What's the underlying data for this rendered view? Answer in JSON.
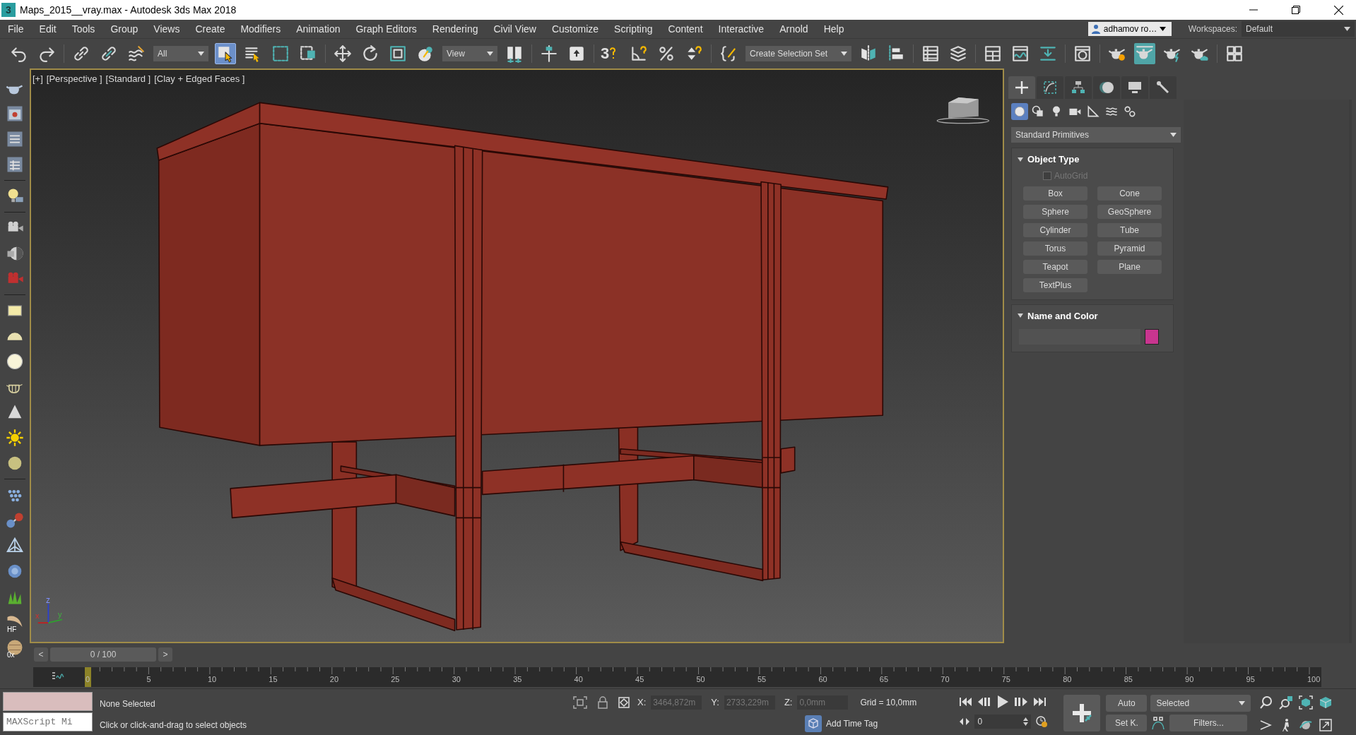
{
  "window": {
    "title": "Maps_2015__vray.max - Autodesk 3ds Max 2018",
    "app_icon": "3"
  },
  "menu": [
    "File",
    "Edit",
    "Tools",
    "Group",
    "Views",
    "Create",
    "Modifiers",
    "Animation",
    "Graph Editors",
    "Rendering",
    "Civil View",
    "Customize",
    "Scripting",
    "Content",
    "Interactive",
    "Arnold",
    "Help"
  ],
  "account": {
    "user": "adhamov ro…"
  },
  "workspaces": {
    "label": "Workspaces:",
    "value": "Default"
  },
  "toolbar": [
    {
      "kind": "undo"
    },
    {
      "kind": "redo"
    },
    {
      "kind": "sep"
    },
    {
      "kind": "link"
    },
    {
      "kind": "unlink"
    },
    {
      "kind": "bind"
    },
    {
      "kind": "dropdown",
      "value": "All"
    },
    {
      "kind": "select",
      "on": true
    },
    {
      "kind": "select_by_name"
    },
    {
      "kind": "region"
    },
    {
      "kind": "crossing"
    },
    {
      "kind": "sep"
    },
    {
      "kind": "move"
    },
    {
      "kind": "rotate"
    },
    {
      "kind": "scale"
    },
    {
      "kind": "placement"
    },
    {
      "kind": "dropdown",
      "value": "View"
    },
    {
      "kind": "pivot"
    },
    {
      "kind": "sep"
    },
    {
      "kind": "manipulate"
    },
    {
      "kind": "keyboard"
    },
    {
      "kind": "sep"
    },
    {
      "kind": "snap",
      "label": "3"
    },
    {
      "kind": "angle"
    },
    {
      "kind": "percent"
    },
    {
      "kind": "spinner"
    },
    {
      "kind": "sep"
    },
    {
      "kind": "braces"
    },
    {
      "kind": "dropdown",
      "value": "Create Selection Set"
    },
    {
      "kind": "mirror"
    },
    {
      "kind": "align"
    },
    {
      "kind": "sep"
    },
    {
      "kind": "scene"
    },
    {
      "kind": "layer"
    },
    {
      "kind": "sep"
    },
    {
      "kind": "ribbon"
    },
    {
      "kind": "curve"
    },
    {
      "kind": "dope"
    },
    {
      "kind": "sep"
    },
    {
      "kind": "material"
    },
    {
      "kind": "sep"
    },
    {
      "kind": "render_setup"
    },
    {
      "kind": "render_frame",
      "on": true
    },
    {
      "kind": "render"
    },
    {
      "kind": "render_cloud"
    },
    {
      "kind": "sep"
    },
    {
      "kind": "tiles"
    }
  ],
  "left_toolbar": [
    {
      "kind": "teapot"
    },
    {
      "kind": "image_window"
    },
    {
      "kind": "list_window"
    },
    {
      "kind": "table_window"
    },
    {
      "kind": "sep"
    },
    {
      "kind": "bulb"
    },
    {
      "kind": "sep"
    },
    {
      "kind": "camera"
    },
    {
      "kind": "camera_moon"
    },
    {
      "kind": "camera_red"
    },
    {
      "kind": "sep"
    },
    {
      "kind": "panel"
    },
    {
      "kind": "dome"
    },
    {
      "kind": "glow"
    },
    {
      "kind": "basket"
    },
    {
      "kind": "cone"
    },
    {
      "kind": "sun"
    },
    {
      "kind": "sphere"
    },
    {
      "kind": "sep"
    },
    {
      "kind": "dots"
    },
    {
      "kind": "molecule"
    },
    {
      "kind": "pyramid"
    },
    {
      "kind": "blob"
    },
    {
      "kind": "grass"
    },
    {
      "kind": "hair",
      "label": "HF"
    },
    {
      "kind": "ball",
      "label": "0x"
    }
  ],
  "viewport": {
    "labels": [
      "[+]",
      "[Perspective ]",
      "[Standard ]",
      "[Clay + Edged Faces ]"
    ],
    "axes": [
      "z",
      "x",
      "y"
    ]
  },
  "command_panel": {
    "tabs": [
      {
        "kind": "create",
        "selected": true
      },
      {
        "kind": "modify",
        "selected": false
      },
      {
        "kind": "hierarchy",
        "selected": false
      },
      {
        "kind": "motion",
        "selected": false
      },
      {
        "kind": "display",
        "selected": false
      },
      {
        "kind": "utilities",
        "selected": false
      }
    ],
    "categories": [
      {
        "kind": "geometry",
        "selected": true
      },
      {
        "kind": "shapes",
        "selected": false
      },
      {
        "kind": "lights",
        "selected": false
      },
      {
        "kind": "cameras",
        "selected": false
      },
      {
        "kind": "helpers",
        "selected": false
      },
      {
        "kind": "space_warps",
        "selected": false
      },
      {
        "kind": "systems",
        "selected": false
      }
    ],
    "dropdown": "Standard Primitives",
    "rollouts": [
      {
        "kind": "object_type",
        "title": "Object Type",
        "expanded": true,
        "autogrid": {
          "label": "AutoGrid",
          "checked": false,
          "disabled": true
        },
        "buttons": [
          "Box",
          "Cone",
          "Sphere",
          "GeoSphere",
          "Cylinder",
          "Tube",
          "Torus",
          "Pyramid",
          "Teapot",
          "Plane",
          "TextPlus"
        ]
      },
      {
        "kind": "name_color",
        "title": "Name and Color",
        "expanded": true,
        "color": "#c8358f"
      }
    ]
  },
  "time_slider": {
    "prev": "<",
    "value": "0 / 100",
    "next": ">",
    "level": 0
  },
  "track_bar": {
    "labels": [
      "0",
      "5",
      "10",
      "15",
      "20",
      "25",
      "30",
      "35",
      "40",
      "45",
      "50",
      "55",
      "60",
      "65",
      "70",
      "75",
      "80",
      "85",
      "90",
      "95",
      "100"
    ]
  },
  "status": {
    "maxscript": "MAXScript Mi",
    "selection": "None Selected",
    "prompt": "Click or click-and-drag to select objects",
    "x_label": "X:",
    "x": "3464,872m",
    "y_label": "Y:",
    "y": "2733,229m",
    "z_label": "Z:",
    "z": "0,0mm",
    "grid": "Grid = 10,0mm",
    "time_tag": "Add Time Tag",
    "frame": "0",
    "auto": "Auto",
    "set_key": "Set K.",
    "key_filter": "Selected",
    "filters": "Filters..."
  }
}
